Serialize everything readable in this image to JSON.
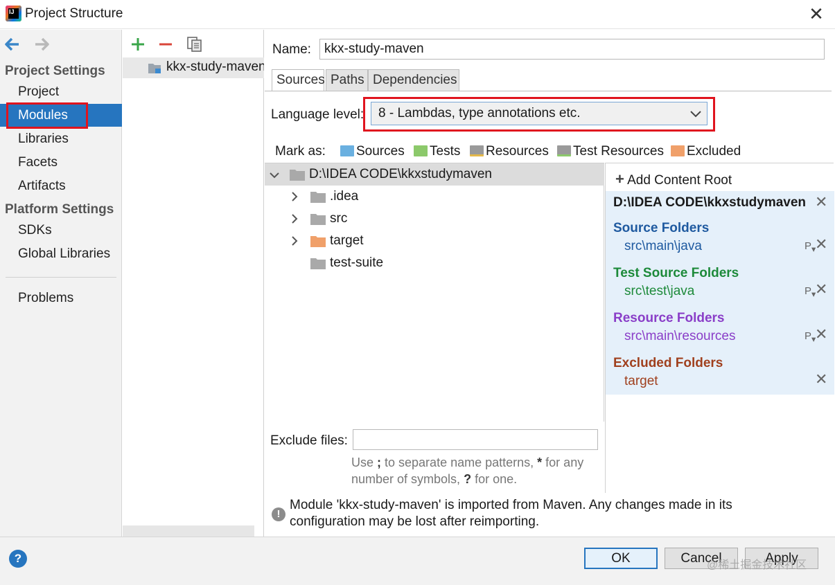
{
  "window": {
    "title": "Project Structure",
    "app_icon_text": "IJ"
  },
  "leftnav": {
    "project_settings_header": "Project Settings",
    "project_items": [
      "Project",
      "Modules",
      "Libraries",
      "Facets",
      "Artifacts"
    ],
    "platform_settings_header": "Platform Settings",
    "platform_items": [
      "SDKs",
      "Global Libraries"
    ],
    "problems": "Problems",
    "selected": "Modules"
  },
  "modules": {
    "items": [
      "kkx-study-maven"
    ]
  },
  "module": {
    "name_label": "Name:",
    "name_value": "kkx-study-maven",
    "tabs": [
      "Sources",
      "Paths",
      "Dependencies"
    ],
    "active_tab": "Sources",
    "language_level_label": "Language level:",
    "language_level_value": "8 - Lambdas, type annotations etc.",
    "mark_as_label": "Mark as:",
    "mark_as": [
      {
        "label": "Sources",
        "color": "#6ab0e0"
      },
      {
        "label": "Tests",
        "color": "#8cc96b"
      },
      {
        "label": "Resources",
        "color": "#9a9a9a"
      },
      {
        "label": "Test Resources",
        "color": "#9a9a9a"
      },
      {
        "label": "Excluded",
        "color": "#f0a06a"
      }
    ],
    "tree": {
      "root": "D:\\IDEA CODE\\kkxstudymaven",
      "children": [
        {
          "label": ".idea",
          "expandable": true,
          "color": "#a9a9a9"
        },
        {
          "label": "src",
          "expandable": true,
          "color": "#a9a9a9"
        },
        {
          "label": "target",
          "expandable": true,
          "color": "#f0a06a"
        },
        {
          "label": "test-suite",
          "expandable": false,
          "color": "#a9a9a9"
        }
      ]
    },
    "content_root": {
      "add_label": "Add Content Root",
      "path": "D:\\IDEA CODE\\kkxstudymaven",
      "groups": [
        {
          "title": "Source Folders",
          "path": "src\\main\\java",
          "color": "#1f5aa0",
          "has_p": true
        },
        {
          "title": "Test Source Folders",
          "path": "src\\test\\java",
          "color": "#1d8a3a",
          "has_p": true
        },
        {
          "title": "Resource Folders",
          "path": "src\\main\\resources",
          "color": "#8a3ec8",
          "has_p": true
        },
        {
          "title": "Excluded Folders",
          "path": "target",
          "color": "#a0401e",
          "has_p": false
        }
      ]
    },
    "exclude_files_label": "Exclude files:",
    "exclude_files_value": "",
    "exclude_hint_parts": [
      "Use ",
      ";",
      " to separate name patterns, ",
      "*",
      " for any number of symbols, ",
      "?",
      " for one."
    ],
    "warning": "Module 'kkx-study-maven' is imported from Maven. Any changes made in its configuration may be lost after reimporting."
  },
  "footer": {
    "help": "?",
    "ok": "OK",
    "cancel": "Cancel",
    "apply": "Apply",
    "watermark": "@稀土掘金技术社区"
  },
  "colors": {
    "selection": "#2675bf",
    "highlight_red": "#e0141e"
  }
}
